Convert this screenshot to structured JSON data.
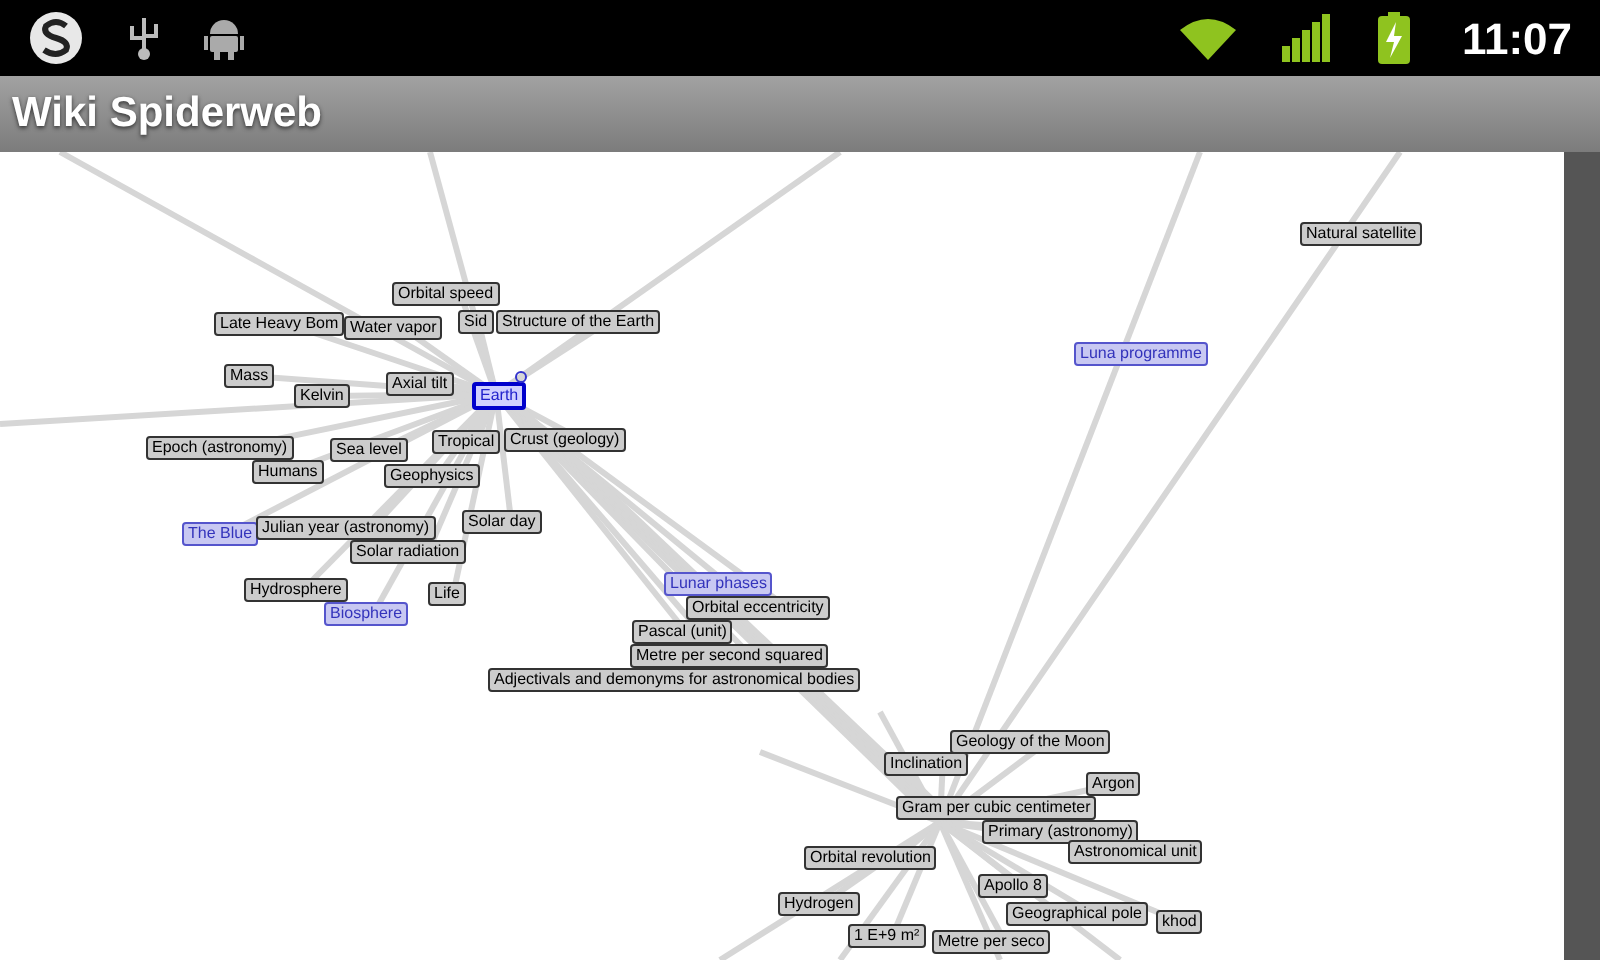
{
  "status_bar": {
    "time": "11:07"
  },
  "app_bar": {
    "title": "Wiki Spiderweb"
  },
  "nodes": [
    {
      "label": "Orbital speed",
      "kind": "plain"
    },
    {
      "label": "Late Heavy Bom",
      "kind": "plain"
    },
    {
      "label": "Water vapor",
      "kind": "plain"
    },
    {
      "label": "Sid",
      "kind": "plain"
    },
    {
      "label": "Structure of the Earth",
      "kind": "plain"
    },
    {
      "label": "Mass",
      "kind": "plain"
    },
    {
      "label": "Kelvin",
      "kind": "plain"
    },
    {
      "label": "Axial tilt",
      "kind": "plain"
    },
    {
      "label": "Earth",
      "kind": "center"
    },
    {
      "label": "Epoch (astronomy)",
      "kind": "plain"
    },
    {
      "label": "Sea level",
      "kind": "plain"
    },
    {
      "label": "Humans",
      "kind": "plain"
    },
    {
      "label": "Tropical",
      "kind": "plain"
    },
    {
      "label": "Crust (geology)",
      "kind": "plain"
    },
    {
      "label": "Geophysics",
      "kind": "plain"
    },
    {
      "label": "Solar day",
      "kind": "plain"
    },
    {
      "label": "The Blue",
      "kind": "link"
    },
    {
      "label": "Julian year (astronomy)",
      "kind": "plain"
    },
    {
      "label": "Solar radiation",
      "kind": "plain"
    },
    {
      "label": "Hydrosphere",
      "kind": "plain"
    },
    {
      "label": "Life",
      "kind": "plain"
    },
    {
      "label": "Biosphere",
      "kind": "link"
    },
    {
      "label": "Lunar phases",
      "kind": "link"
    },
    {
      "label": "Orbital eccentricity",
      "kind": "plain"
    },
    {
      "label": "Pascal (unit)",
      "kind": "plain"
    },
    {
      "label": "Metre per second squared",
      "kind": "plain"
    },
    {
      "label": "Adjectivals and demonyms for astronomical bodies",
      "kind": "plain"
    },
    {
      "label": "Natural satellite",
      "kind": "plain"
    },
    {
      "label": "Luna programme",
      "kind": "link"
    },
    {
      "label": "Geology of the Moon",
      "kind": "plain"
    },
    {
      "label": "Inclination",
      "kind": "plain"
    },
    {
      "label": "Argon",
      "kind": "plain"
    },
    {
      "label": "Gram per cubic centimeter",
      "kind": "plain"
    },
    {
      "label": "Primary (astronomy)",
      "kind": "plain"
    },
    {
      "label": "Astronomical unit",
      "kind": "plain"
    },
    {
      "label": "Orbital revolution",
      "kind": "plain"
    },
    {
      "label": "Apollo 8",
      "kind": "plain"
    },
    {
      "label": "Hydrogen",
      "kind": "plain"
    },
    {
      "label": "Geographical pole",
      "kind": "plain"
    },
    {
      "label": "khod",
      "kind": "plain"
    },
    {
      "label": "1 E+9 m²",
      "kind": "plain"
    },
    {
      "label": "Metre per seco",
      "kind": "plain"
    }
  ]
}
